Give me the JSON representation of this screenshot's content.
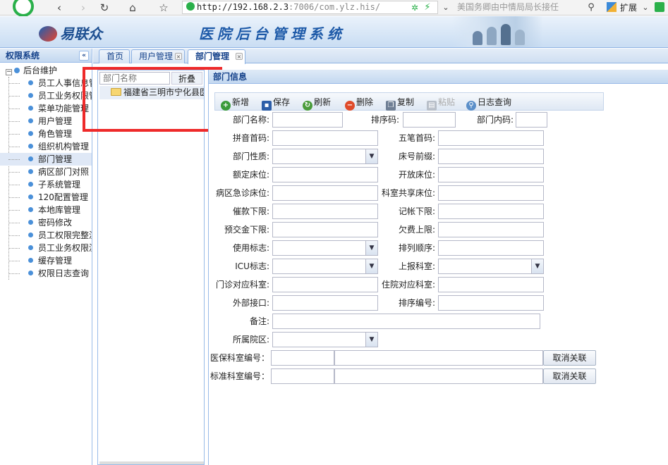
{
  "browser": {
    "url_host": "http://192.168.2.3",
    "url_rest": ":7006/com.ylz.his/",
    "search_text": "美国务卿由中情局局长接任",
    "extensions_label": "扩展"
  },
  "header": {
    "logo_text": "易联众",
    "system_title": "医院后台管理系统"
  },
  "sidebar": {
    "title": "权限系统",
    "root_label": "后台维护",
    "items": [
      {
        "label": "员工人事信息管理"
      },
      {
        "label": "员工业务权限管理"
      },
      {
        "label": "菜单功能管理"
      },
      {
        "label": "用户管理"
      },
      {
        "label": "角色管理"
      },
      {
        "label": "组织机构管理"
      },
      {
        "label": "部门管理"
      },
      {
        "label": "病区部门对照"
      },
      {
        "label": "子系统管理"
      },
      {
        "label": "120配置管理"
      },
      {
        "label": "本地库管理"
      },
      {
        "label": "密码修改"
      },
      {
        "label": "员工权限完整演示"
      },
      {
        "label": "员工业务权限演示"
      },
      {
        "label": "缓存管理"
      },
      {
        "label": "权限日志查询"
      }
    ]
  },
  "tabs": [
    {
      "label": "首页"
    },
    {
      "label": "用户管理"
    },
    {
      "label": "部门管理"
    }
  ],
  "tree_panel": {
    "search_placeholder": "部门名称",
    "fold_label": "折叠",
    "node_label": "福建省三明市宁化县医院"
  },
  "dept_panel": {
    "title": "部门信息",
    "toolbar": {
      "add": "新增",
      "save": "保存",
      "refresh": "刷新",
      "delete": "删除",
      "copy": "复制",
      "paste": "粘贴",
      "log": "日志查询"
    },
    "labels": {
      "dept_name": "部门名称:",
      "sort_code": "排序码:",
      "dept_code": "部门内码:",
      "pinyin": "拼音首码:",
      "wubi": "五笔首码:",
      "dept_type": "部门性质:",
      "bed_prefix": "床号前缀:",
      "rated_beds": "额定床位:",
      "open_beds": "开放床位:",
      "ward_emergency_beds": "病区急诊床位:",
      "shared_beds": "科室共享床位:",
      "dunning_limit": "催款下限:",
      "charge_limit": "记帐下限:",
      "deposit_limit": "预交金下限:",
      "arrears_limit": "欠费上限:",
      "usage_flag": "使用标志:",
      "order": "排列顺序:",
      "icu_flag": "ICU标志:",
      "report_dept": "上报科室:",
      "outpatient_dept": "门诊对应科室:",
      "inpatient_dept": "住院对应科室:",
      "external_api": "外部接口:",
      "sort_no": "排序编号:",
      "remark": "备注:",
      "campus": "所属院区:",
      "insurance_code": "医保科室编号：",
      "standard_code": "标准科室编号："
    },
    "unlink_label": "取消关联"
  }
}
